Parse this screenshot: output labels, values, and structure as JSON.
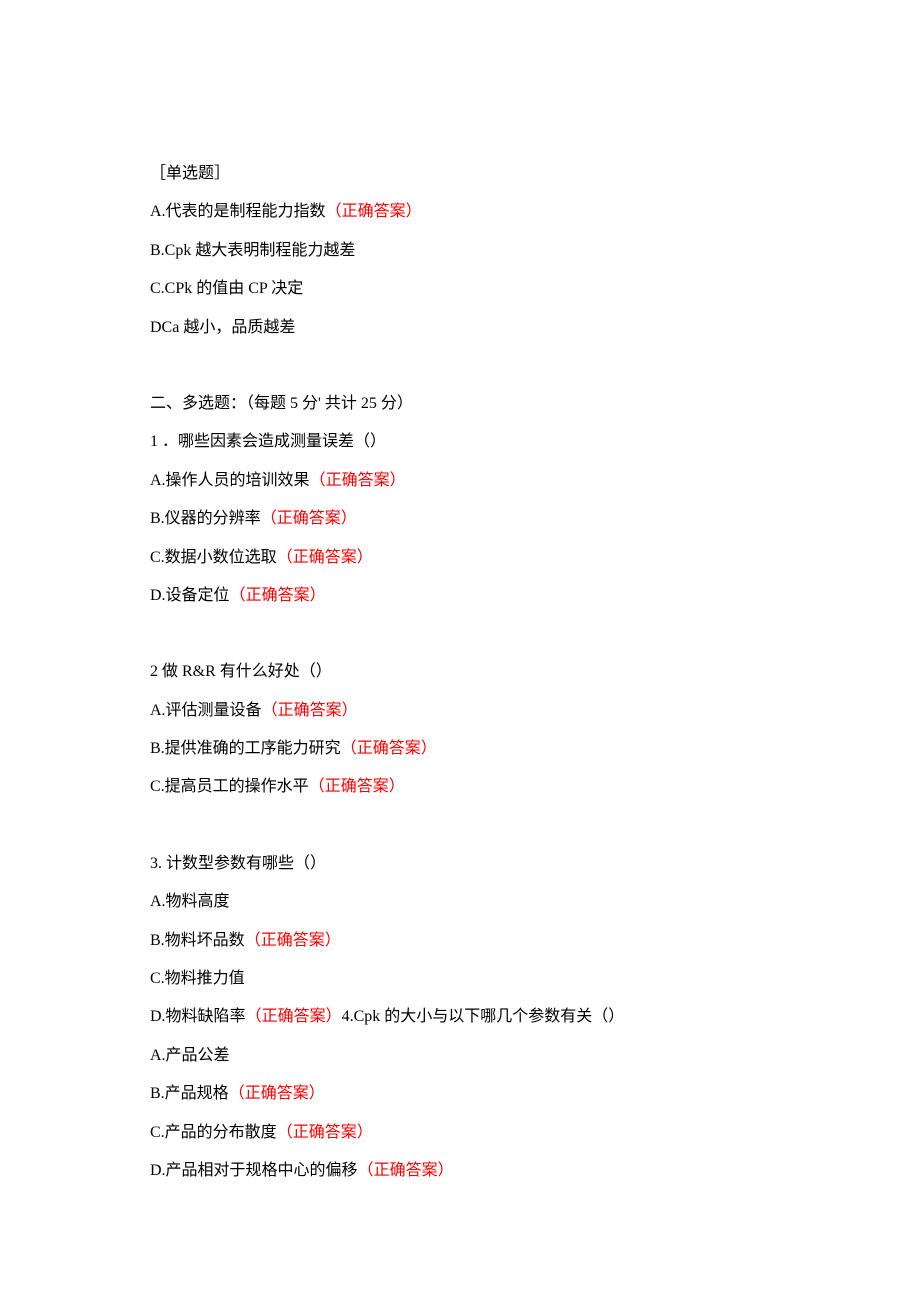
{
  "header": "［单选题］",
  "q0": {
    "a_text": "A.代表的是制程能力指数",
    "a_correct": "（正确答案）",
    "b": "B.Cpk 越大表明制程能力越差",
    "c": "C.CPk 的值由 CP 决定",
    "d": "DCa 越小，品质越差"
  },
  "section2_header": "二、多选题：（每题 5 分' 共计 25 分）",
  "q1": {
    "prompt": "1 ．哪些因素会造成测量误差（）",
    "a_text": "A.操作人员的培训效果",
    "a_correct": "（正确答案）",
    "b_text": "B.仪器的分辨率",
    "b_correct": "（正确答案）",
    "c_text": "C.数据小数位选取",
    "c_correct": "（正确答案）",
    "d_text": "D.设备定位",
    "d_correct": "（正确答案）"
  },
  "q2": {
    "prompt": "2 做 R&R 有什么好处（）",
    "a_text": "A.评估测量设备",
    "a_correct": "（正确答案）",
    "b_text": "B.提供准确的工序能力研究",
    "b_correct": "（正确答案）",
    "c_text": "C.提高员工的操作水平",
    "c_correct": "（正确答案）"
  },
  "q3": {
    "prompt": "3. 计数型参数有哪些（）",
    "a": "A.物料高度",
    "b_text": "B.物料坏品数",
    "b_correct": "（正确答案）",
    "c": "C.物料推力值",
    "d_text": "D.物料缺陷率",
    "d_correct": "（正确答案）",
    "q4_prompt": "4.Cpk 的大小与以下哪几个参数有关（）"
  },
  "q4": {
    "a": "A.产品公差",
    "b_text": "B.产品规格",
    "b_correct": "（正确答案）",
    "c_text": "C.产品的分布散度",
    "c_correct": "（正确答案）",
    "d_text": "D.产品相对于规格中心的偏移",
    "d_correct": "（正确答案）"
  }
}
